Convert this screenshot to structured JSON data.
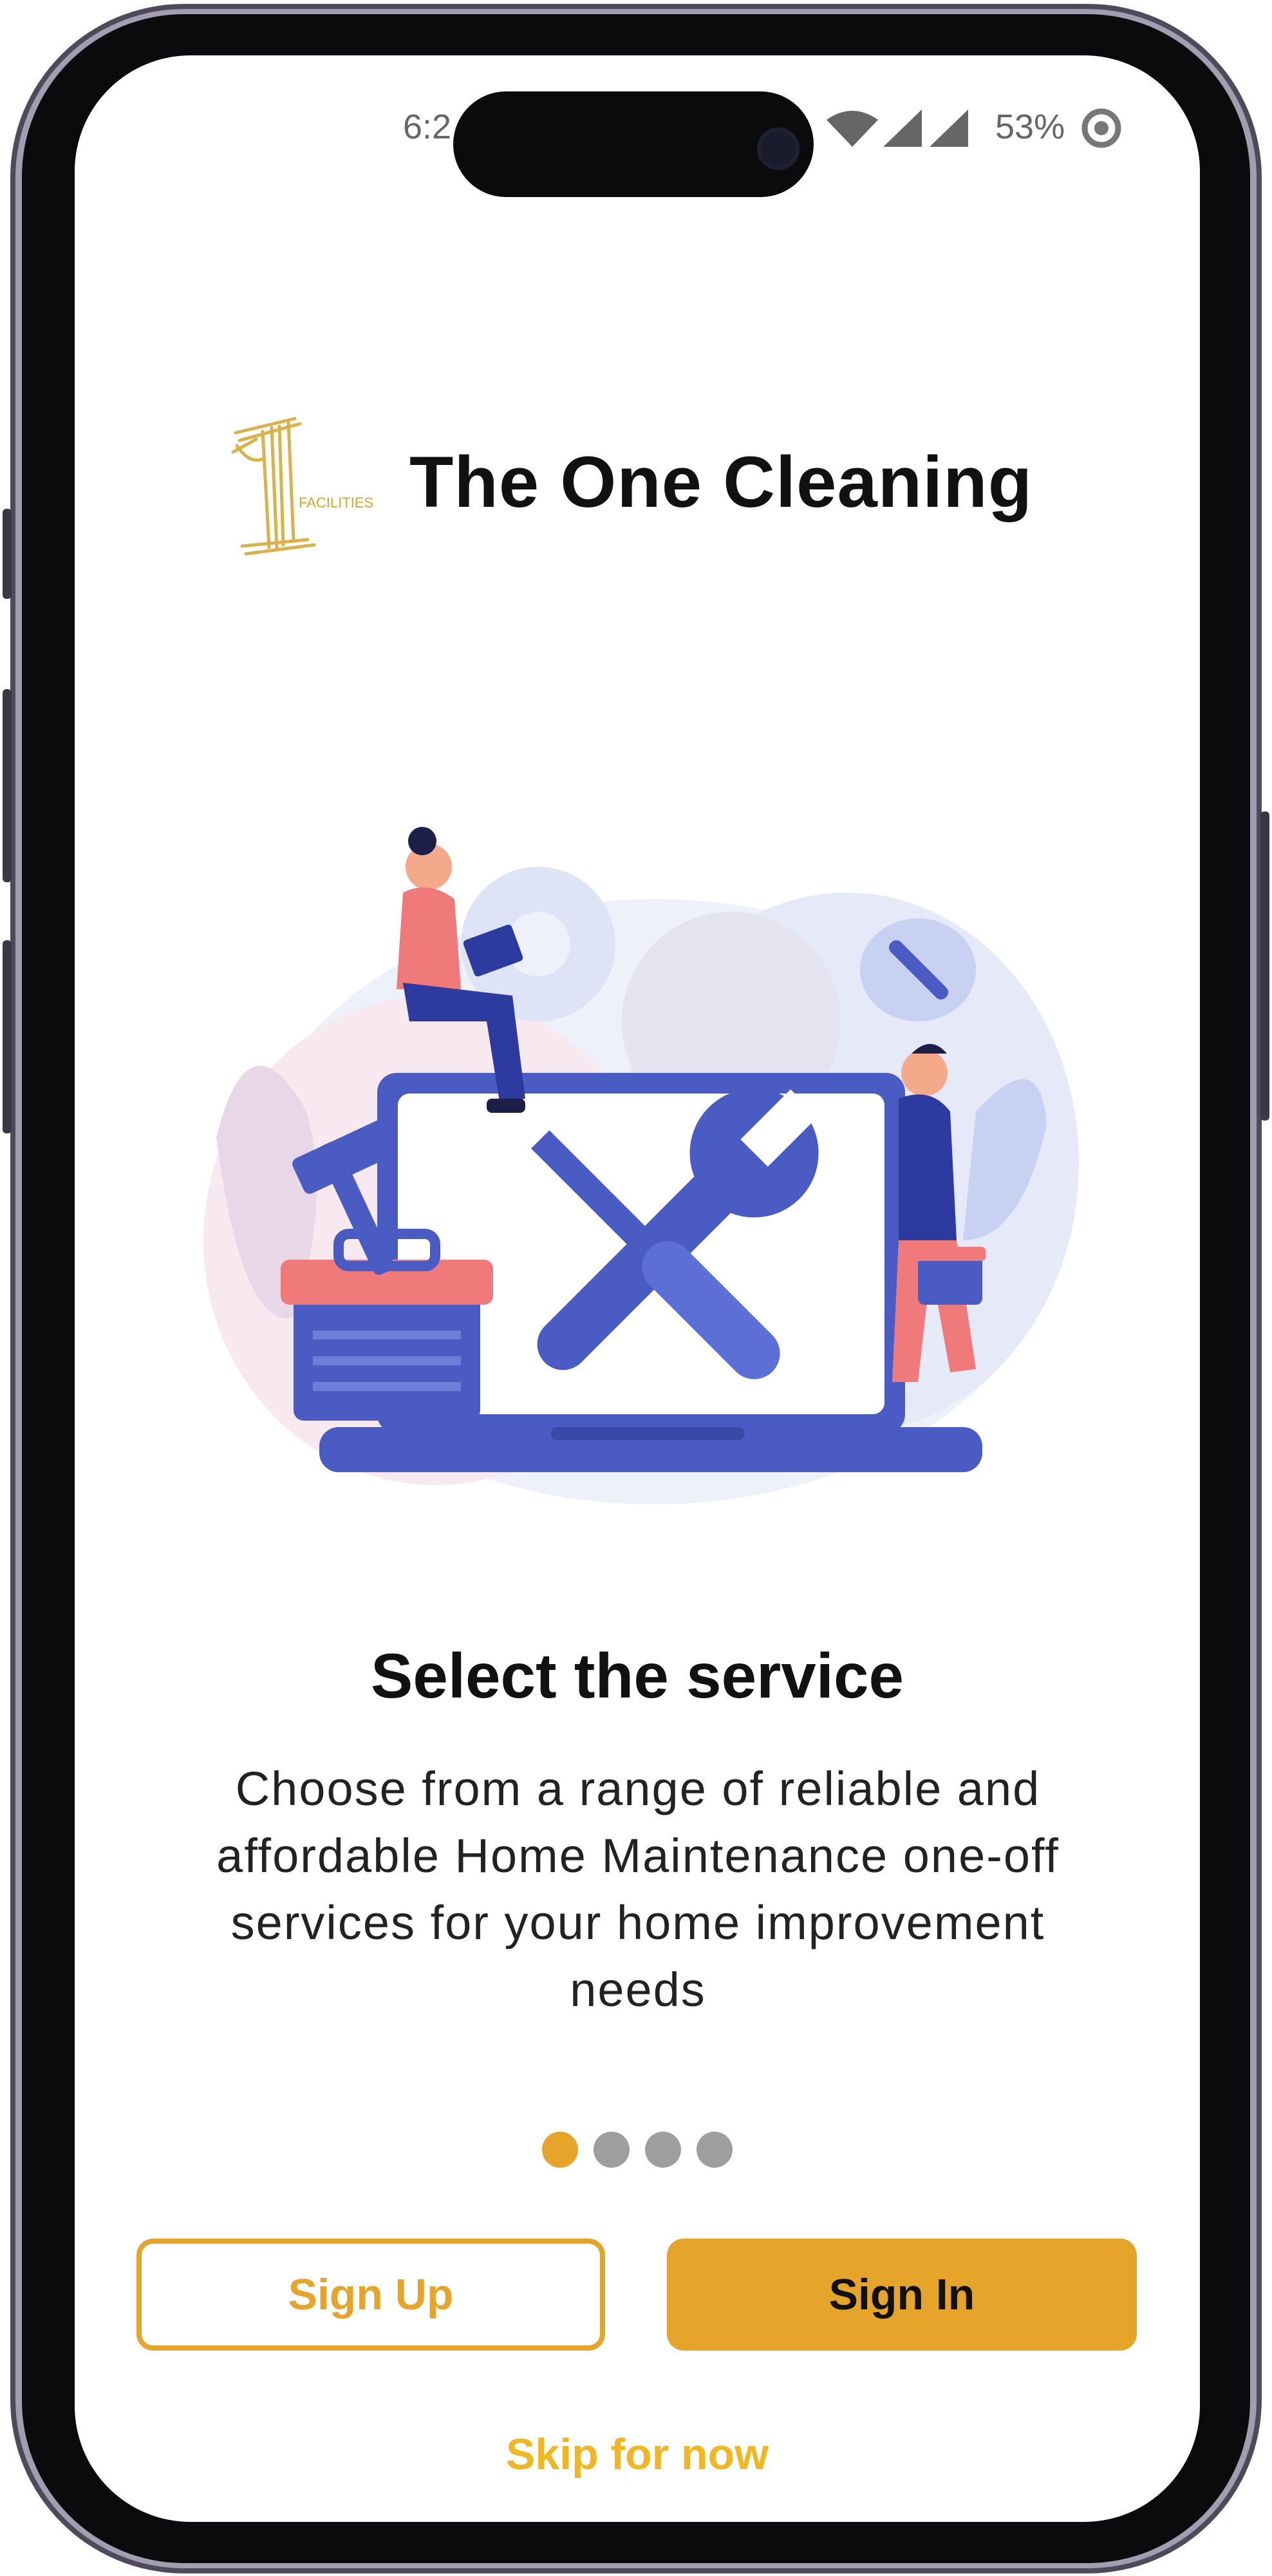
{
  "status_bar": {
    "time": "6:2",
    "battery": "53%",
    "icons": [
      "wifi-icon",
      "signal-icon",
      "signal-icon",
      "battery-ring-icon"
    ]
  },
  "brand": {
    "name": "The One Cleaning",
    "logo_text": "FACILITIES"
  },
  "slide": {
    "title": "Select the service",
    "description": "Choose from a range of reliable and affordable Home Maintenance one-off services for your home improvement needs",
    "illustration": "repair-tools-laptop-illustration"
  },
  "pagination": {
    "total": 4,
    "active_index": 0
  },
  "actions": {
    "sign_up": "Sign Up",
    "sign_in": "Sign In",
    "skip": "Skip for now"
  },
  "colors": {
    "accent": "#e6a52a",
    "skip": "#f2b620",
    "dot_inactive": "#9e9e9e",
    "illustration_primary": "#4a5bc4",
    "illustration_secondary": "#f07a7a"
  }
}
